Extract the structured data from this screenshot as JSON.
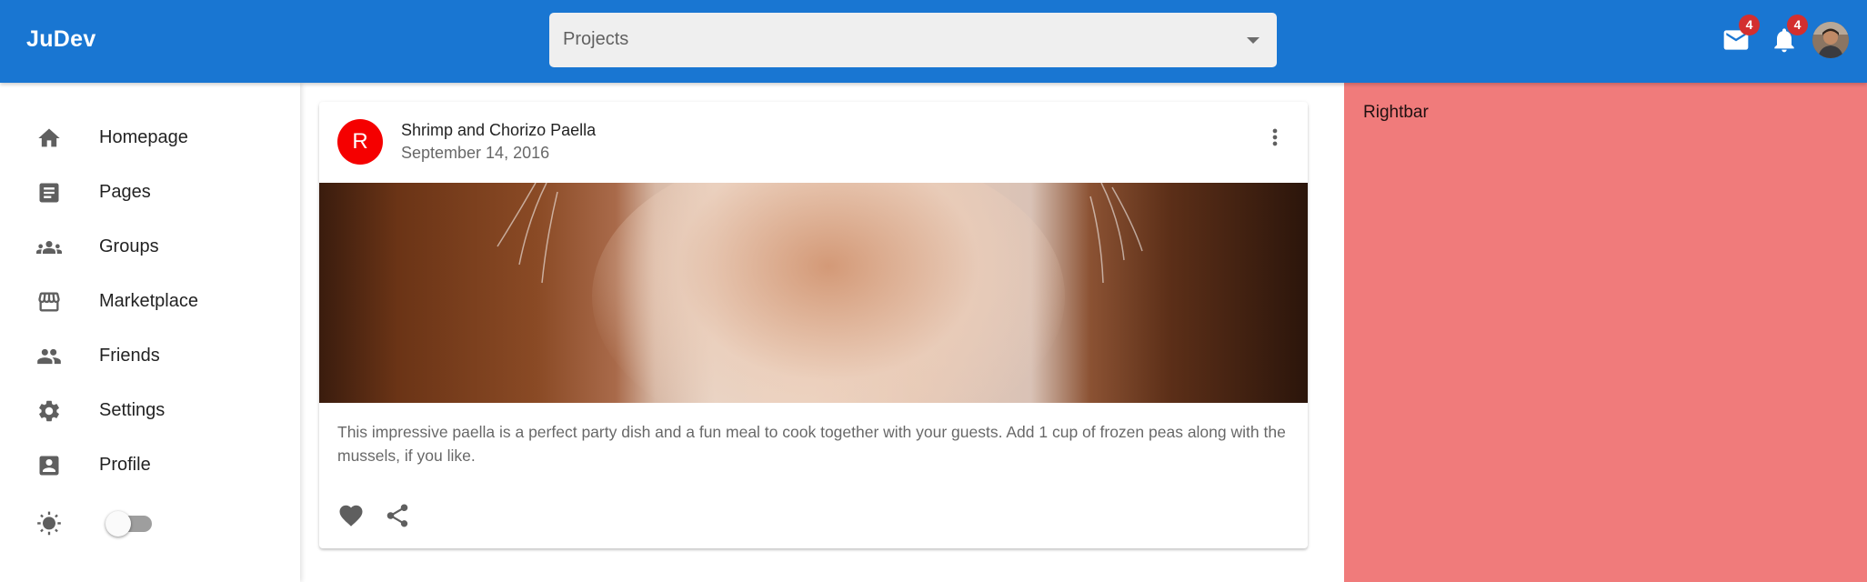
{
  "app": {
    "logo": "JuDev",
    "brand_color": "#1976d2"
  },
  "search": {
    "value": "Projects",
    "icon": "chevron-down-icon"
  },
  "header_actions": {
    "mail_badge": "4",
    "notifications_badge": "4",
    "badge_color": "#d32f2f"
  },
  "sidebar": {
    "items": [
      {
        "label": "Homepage",
        "icon": "home-icon"
      },
      {
        "label": "Pages",
        "icon": "article-icon"
      },
      {
        "label": "Groups",
        "icon": "groups-icon"
      },
      {
        "label": "Marketplace",
        "icon": "storefront-icon"
      },
      {
        "label": "Friends",
        "icon": "people-icon"
      },
      {
        "label": "Settings",
        "icon": "gear-icon"
      },
      {
        "label": "Profile",
        "icon": "account-box-icon"
      }
    ],
    "theme_toggle": {
      "icon": "sun-icon",
      "checked": false
    }
  },
  "post": {
    "avatar_letter": "R",
    "avatar_color": "#f50000",
    "title": "Shrimp and Chorizo Paella",
    "date": "September 14, 2016",
    "description": "This impressive paella is a perfect party dish and a fun meal to cook together with your guests. Add 1 cup of frozen peas along with the mussels, if you like."
  },
  "rightbar": {
    "label": "Rightbar",
    "background": "#f07b7b"
  }
}
